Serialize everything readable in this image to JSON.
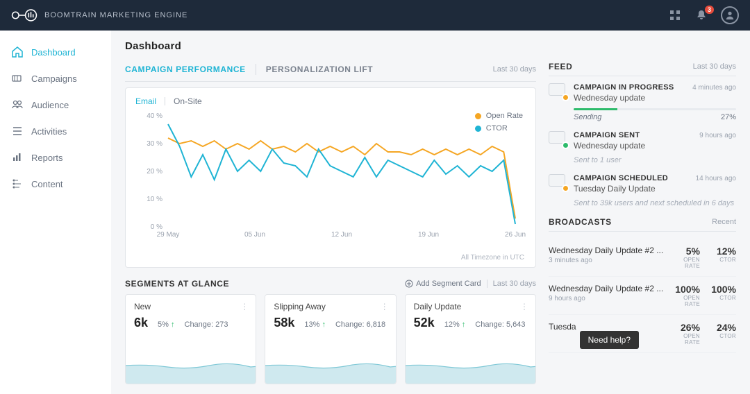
{
  "brand": "BOOMTRAIN MARKETING ENGINE",
  "notification_count": 3,
  "sidebar": {
    "items": [
      {
        "label": "Dashboard",
        "active": true,
        "icon": "home"
      },
      {
        "label": "Campaigns",
        "active": false,
        "icon": "megaphone"
      },
      {
        "label": "Audience",
        "active": false,
        "icon": "people"
      },
      {
        "label": "Activities",
        "active": false,
        "icon": "list"
      },
      {
        "label": "Reports",
        "active": false,
        "icon": "chart"
      },
      {
        "label": "Content",
        "active": false,
        "icon": "tree"
      }
    ]
  },
  "page_title": "Dashboard",
  "performance": {
    "tabs": [
      "CAMPAIGN PERFORMANCE",
      "PERSONALIZATION LIFT"
    ],
    "active_tab": 0,
    "range_label": "Last 30 days",
    "subtabs": [
      "Email",
      "On-Site"
    ],
    "active_subtab": 0,
    "legend": [
      {
        "label": "Open Rate",
        "color": "#f5a623"
      },
      {
        "label": "CTOR",
        "color": "#1fb4d4"
      }
    ],
    "timezone_note": "All Timezone in UTC"
  },
  "chart_data": {
    "type": "line",
    "xlabel": "",
    "ylabel": "",
    "ylim": [
      0,
      40
    ],
    "y_ticks": [
      "0 %",
      "10 %",
      "20 %",
      "30 %",
      "40 %"
    ],
    "x_ticks": [
      "29 May",
      "05 Jun",
      "12 Jun",
      "19 Jun",
      "26 Jun"
    ],
    "x": [
      0,
      1,
      2,
      3,
      4,
      5,
      6,
      7,
      8,
      9,
      10,
      11,
      12,
      13,
      14,
      15,
      16,
      17,
      18,
      19,
      20,
      21,
      22,
      23,
      24,
      25,
      26,
      27,
      28,
      29,
      30
    ],
    "series": [
      {
        "name": "Open Rate",
        "color": "#f5a623",
        "values": [
          32,
          30,
          31,
          29,
          31,
          28,
          30,
          28,
          31,
          28,
          29,
          27,
          30,
          27,
          29,
          27,
          29,
          26,
          30,
          27,
          27,
          26,
          28,
          26,
          28,
          26,
          28,
          26,
          29,
          27,
          3
        ]
      },
      {
        "name": "CTOR",
        "color": "#1fb4d4",
        "values": [
          37,
          29,
          18,
          26,
          17,
          28,
          20,
          24,
          20,
          28,
          23,
          22,
          18,
          28,
          22,
          20,
          18,
          25,
          18,
          24,
          22,
          20,
          18,
          24,
          19,
          22,
          18,
          22,
          20,
          24,
          1
        ]
      }
    ]
  },
  "segments": {
    "title": "SEGMENTS AT GLANCE",
    "add_label": "Add Segment Card",
    "range_label": "Last 30 days",
    "cards": [
      {
        "name": "New",
        "value": "6k",
        "pct": "5%",
        "change_label": "Change:",
        "change": "273"
      },
      {
        "name": "Slipping Away",
        "value": "58k",
        "pct": "13%",
        "change_label": "Change:",
        "change": "6,818"
      },
      {
        "name": "Daily Update",
        "value": "52k",
        "pct": "12%",
        "change_label": "Change:",
        "change": "5,643"
      }
    ]
  },
  "feed": {
    "title": "FEED",
    "range_label": "Last 30 days",
    "items": [
      {
        "status": "CAMPAIGN IN PROGRESS",
        "name": "Wednesday update",
        "time": "4 minutes ago",
        "status_color": "#f5a623",
        "progress": 27,
        "progress_label": "Sending",
        "progress_pct": "27%"
      },
      {
        "status": "CAMPAIGN SENT",
        "name": "Wednesday update",
        "time": "9 hours ago",
        "status_color": "#2dbb6b",
        "sub": "Sent to 1 user"
      },
      {
        "status": "CAMPAIGN SCHEDULED",
        "name": "Tuesday Daily Update",
        "time": "14 hours ago",
        "status_color": "#f5a623",
        "sub": "Sent to 39k users and next scheduled in 6 days"
      }
    ]
  },
  "broadcasts": {
    "title": "BROADCASTS",
    "range_label": "Recent",
    "open_label": "OPEN RATE",
    "ctor_label": "CTOR",
    "items": [
      {
        "name": "Wednesday Daily Update #2 ...",
        "time": "3 minutes ago",
        "open": "5%",
        "ctor": "12%"
      },
      {
        "name": "Wednesday Daily Update #2 ...",
        "time": "9 hours ago",
        "open": "100%",
        "ctor": "100%"
      },
      {
        "name": "Tuesda",
        "time": "",
        "open": "26%",
        "ctor": "24%"
      }
    ]
  },
  "help_label": "Need help?"
}
